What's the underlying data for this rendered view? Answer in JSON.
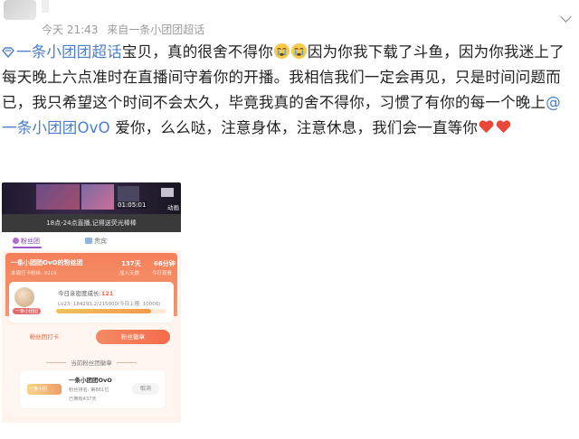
{
  "post": {
    "username": "",
    "time": "今天 21:43",
    "source": "来自一条小团团超话",
    "topic_link": "一条小团团超话",
    "text_1": "宝贝，真的很舍不得你",
    "text_2": "因为你我下载了斗鱼，因为你我迷上了每天晚上六点准时在直播间守着你的开播。我相信我们一定会再见，只是时间问题而已，我只希望这个时间不会太久，毕竟我真的舍不得你，习惯了有你的每一个晚上",
    "mention": "@一条小团团OvO",
    "text_3": " 爱你，么么哒，注意身体，注意休息，我们会一直等你",
    "emojis": [
      "crying-emoji",
      "crying-emoji"
    ],
    "hearts": [
      "heart-emoji",
      "heart-emoji"
    ]
  },
  "screenshot": {
    "timer": "01:05:01",
    "side_label": "动画",
    "caption": "18点-24点直播,记得送荧光棒棒",
    "tab_fan": "粉丝团",
    "tab_2": "贵宾",
    "club_name": "一条小团团OvO的粉丝团",
    "club_sub": "本周打卡粉丝: 9219",
    "days_value": "137天",
    "days_label": "加入天数",
    "mins_value": "66分钟",
    "mins_label": "今日观看",
    "badge_tag": "一条小团团",
    "growth_label": "今日亲密度成长:",
    "growth_value": "121",
    "level_text": "Lv23: 184293.2/215000(今日上限: 10000)",
    "progress_fraction": 0.86,
    "btn_sign": "粉丝团打卡",
    "btn_badge": "粉丝徽章",
    "current_title": "当前粉丝团徽章",
    "small_badge_label": "一条小团",
    "bc_name": "一条小团团OvO",
    "bc_rank": "粉丝排名: 第861位",
    "bc_days": "已拥有437天",
    "btn_cancel": "取消"
  }
}
